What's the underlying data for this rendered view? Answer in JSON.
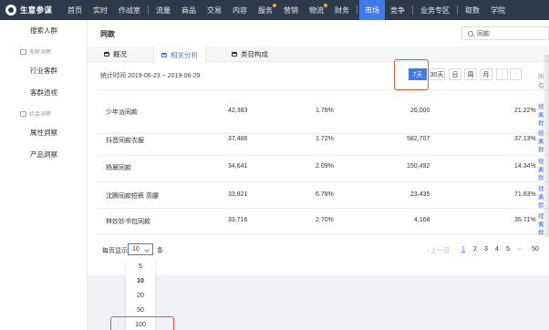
{
  "nav": {
    "logo": "生意参谋",
    "items": [
      "首页",
      "实时",
      "作战室",
      "流量",
      "商品",
      "交易",
      "内容",
      "服务",
      "营销",
      "物流",
      "财务",
      "市场",
      "竞争",
      "业务专区",
      "取数",
      "学院"
    ],
    "active": "市场"
  },
  "sidebar": {
    "items": [
      {
        "label": "搜索人群"
      },
      {
        "group": "客群洞察"
      },
      {
        "label": "行业客群"
      },
      {
        "label": "客群透视"
      },
      {
        "group": "机会洞察"
      },
      {
        "label": "属性洞察"
      },
      {
        "label": "产品洞察"
      }
    ]
  },
  "main": {
    "title": "同款",
    "search_value": "同款",
    "tabs": [
      "概况",
      "相关分析",
      "类目构成"
    ],
    "active_tab": "相关分析",
    "period": "统计时间 2019-06-23 ~ 2019-06-29",
    "range_buttons": [
      "7天",
      "30天",
      "日",
      "周",
      "月"
    ],
    "active_range": "7天",
    "right_truncated": "所有",
    "action_links": [
      "搜索",
      "人群"
    ],
    "table_rows": [
      {
        "keyword": "少年派同款",
        "v1": "42,383",
        "v2": "1.78%",
        "v3": "26,000",
        "v4": "21.22%"
      },
      {
        "keyword": "抖音同款衣服",
        "v1": "37,486",
        "v2": "1.72%",
        "v3": "582,707",
        "v4": "37.13%"
      },
      {
        "keyword": "杨幂同款",
        "v1": "34,641",
        "v2": "2.09%",
        "v3": "150,492",
        "v4": "14.34%"
      },
      {
        "keyword": "沈腾同款短裤 高腰",
        "v1": "33,821",
        "v2": "6.78%",
        "v3": "23,435",
        "v4": "71.83%"
      },
      {
        "keyword": "林妙妙书包同款",
        "v1": "33,716",
        "v2": "2.70%",
        "v3": "4,168",
        "v4": "35.71%"
      }
    ],
    "pagination": {
      "per_page_label": "每页显示",
      "per_page_value": "10",
      "unit": "条",
      "prev": "上一页",
      "pages": [
        "1",
        "2",
        "3",
        "4",
        "5",
        "···",
        "50"
      ],
      "current": "1"
    },
    "per_page_options": [
      "5",
      "10",
      "20",
      "50",
      "100"
    ],
    "selected_option": "10"
  },
  "colors": {
    "nav_bg": "#2d3a4b",
    "accent": "#3e7be8",
    "highlight": "#e8562a"
  }
}
